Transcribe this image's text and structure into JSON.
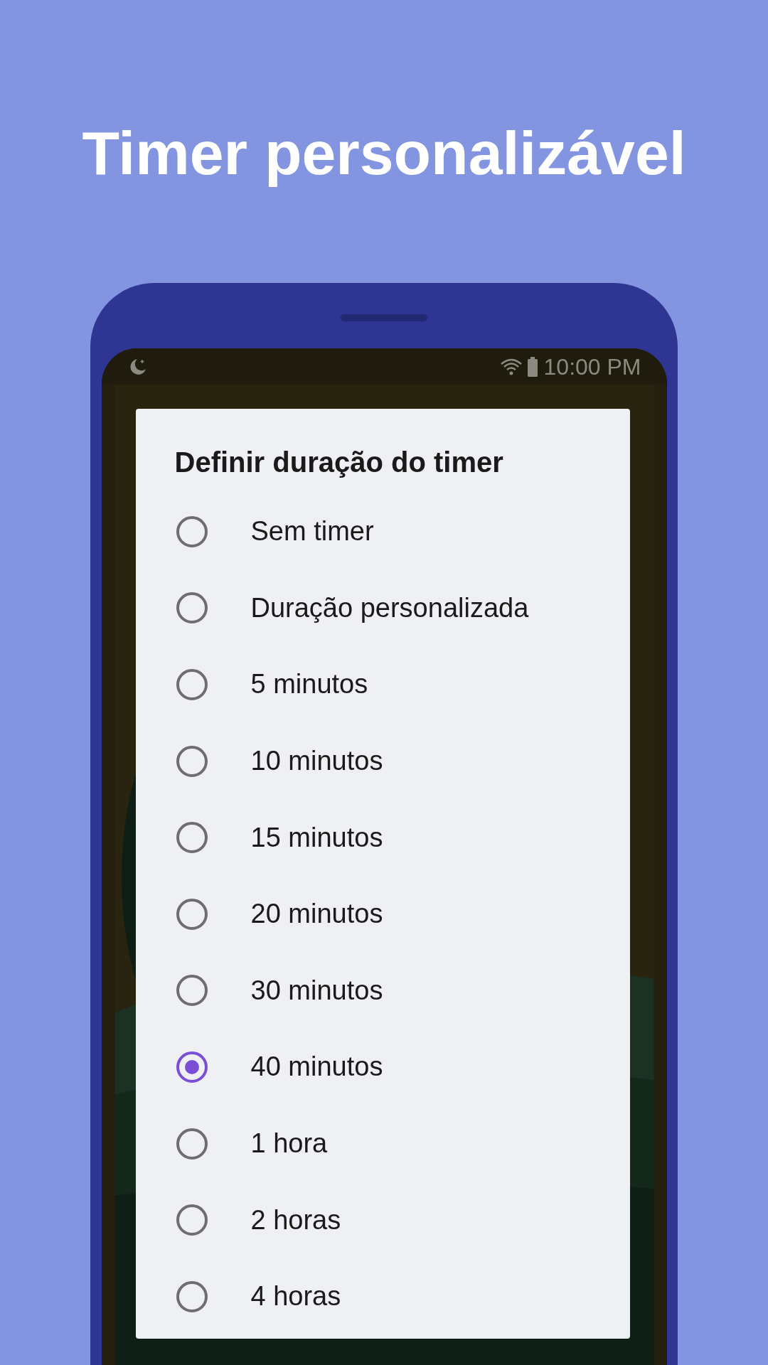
{
  "headline": "Timer personalizável",
  "status_bar": {
    "time": "10:00 PM"
  },
  "dialog": {
    "title": "Definir duração do timer",
    "options": [
      {
        "label": "Sem timer",
        "selected": false
      },
      {
        "label": "Duração personalizada",
        "selected": false
      },
      {
        "label": "5 minutos",
        "selected": false
      },
      {
        "label": "10 minutos",
        "selected": false
      },
      {
        "label": "15 minutos",
        "selected": false
      },
      {
        "label": "20 minutos",
        "selected": false
      },
      {
        "label": "30 minutos",
        "selected": false
      },
      {
        "label": "40 minutos",
        "selected": true
      },
      {
        "label": "1 hora",
        "selected": false
      },
      {
        "label": "2 horas",
        "selected": false
      },
      {
        "label": "4 horas",
        "selected": false
      }
    ]
  }
}
